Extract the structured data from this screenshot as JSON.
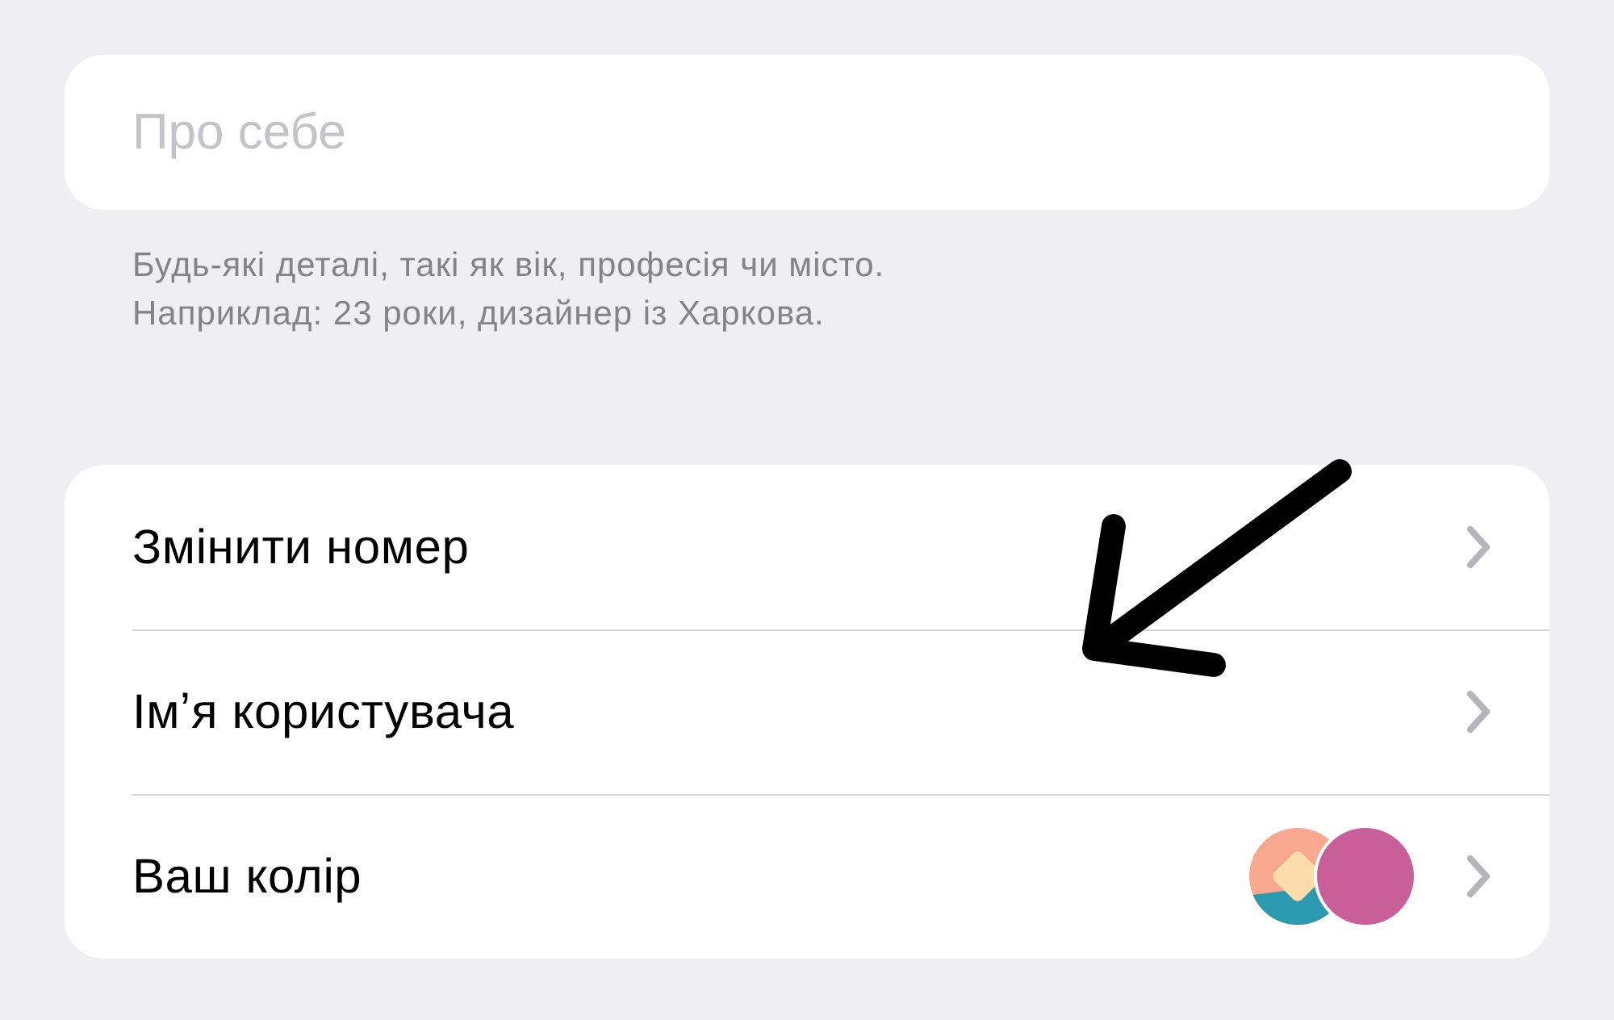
{
  "bio": {
    "placeholder": "Про себе"
  },
  "hint": [
    "Будь-які деталі, такі як вік, професія чи місто.",
    "Наприклад: 23 роки, дизайнер із Харкова."
  ],
  "settings": [
    {
      "label": "Змінити номер",
      "kind": "plain"
    },
    {
      "label": "Імʼя користувача",
      "kind": "plain"
    },
    {
      "label": "Ваш колір",
      "kind": "color"
    }
  ]
}
